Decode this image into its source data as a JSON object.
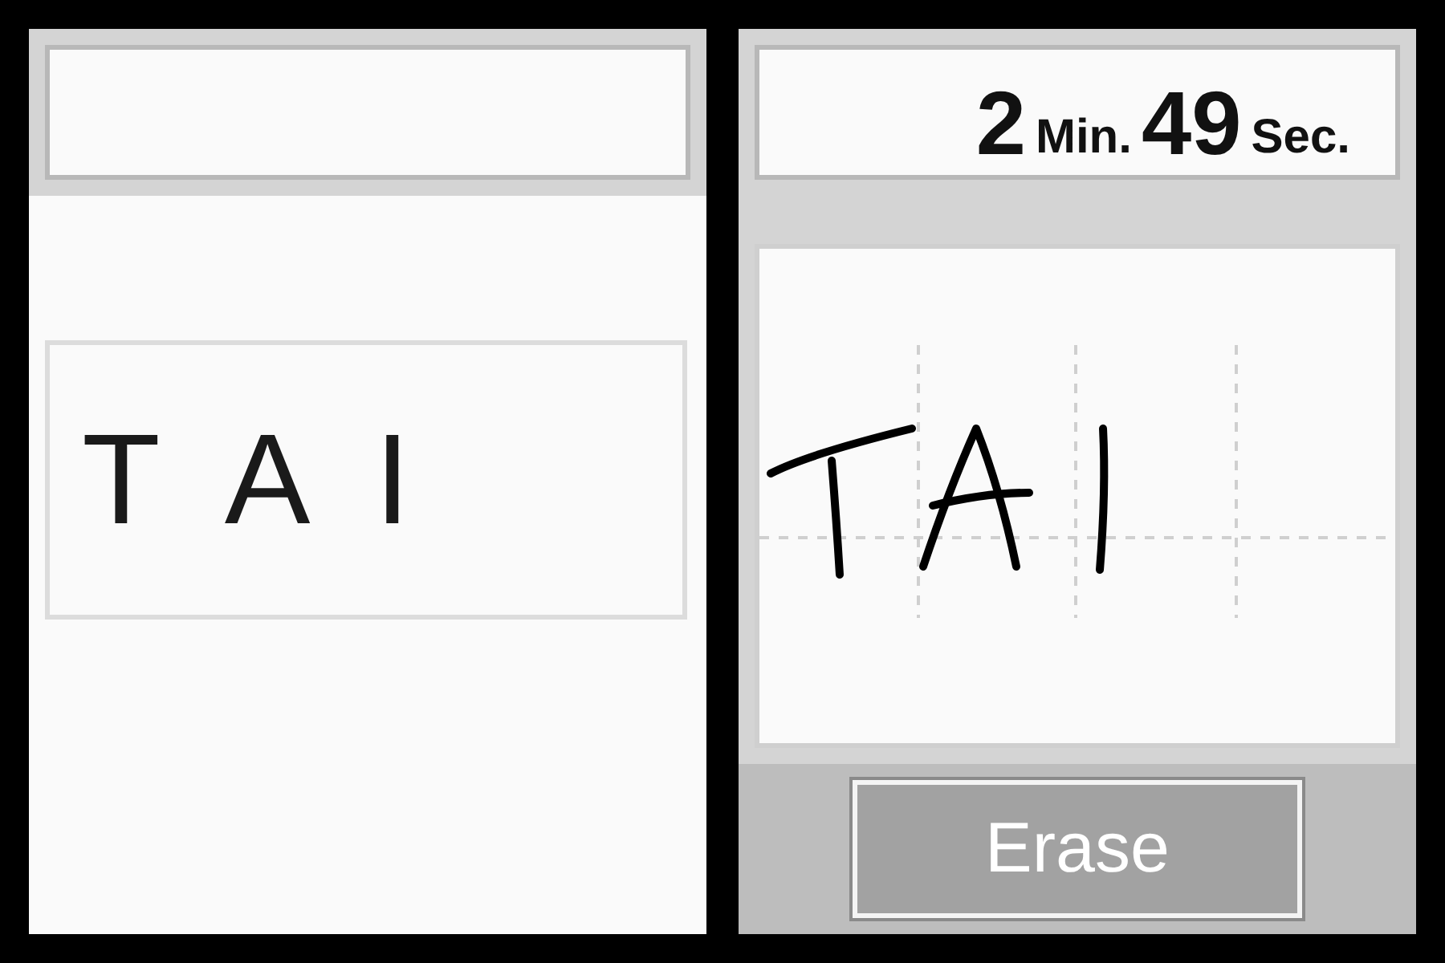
{
  "top_screen": {
    "word_card": {
      "letters": [
        "T",
        "A",
        "I"
      ]
    }
  },
  "bottom_screen": {
    "timer": {
      "minutes": "2",
      "minutes_unit": "Min.",
      "seconds": "49",
      "seconds_unit": "Sec."
    },
    "writing_pad": {
      "kind": "handwriting"
    },
    "erase_button": {
      "label": "Erase"
    }
  }
}
